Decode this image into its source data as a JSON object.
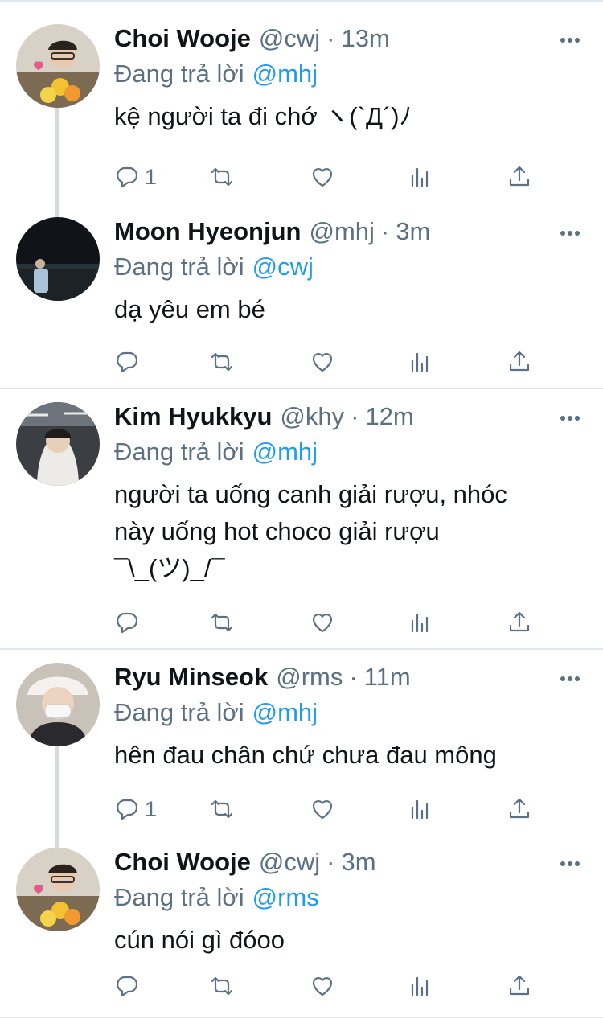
{
  "replying_prefix": "Đang trả lời",
  "tweets": [
    {
      "name": "Choi Wooje",
      "handle": "@cwj",
      "separator": "·",
      "time": "13m",
      "reply_to": "@mhj",
      "text": "kệ người ta đi chớ ヽ(`Д´)ﾉ",
      "reply_count": "1"
    },
    {
      "name": "Moon Hyeonjun",
      "handle": "@mhj",
      "separator": "·",
      "time": "3m",
      "reply_to": "@cwj",
      "text": "dạ yêu em bé",
      "reply_count": ""
    },
    {
      "name": "Kim Hyukkyu",
      "handle": "@khy",
      "separator": "·",
      "time": "12m",
      "reply_to": "@mhj",
      "text": "người ta uống canh giải rượu, nhóc\nnày uống hot choco giải rượu\n¯\\_(ツ)_/¯",
      "reply_count": ""
    },
    {
      "name": "Ryu Minseok",
      "handle": "@rms",
      "separator": "·",
      "time": "11m",
      "reply_to": "@mhj",
      "text": "hên đau chân chứ chưa đau mông",
      "reply_count": "1"
    },
    {
      "name": "Choi Wooje",
      "handle": "@cwj",
      "separator": "·",
      "time": "3m",
      "reply_to": "@rms",
      "text": "cún nói gì đóoo",
      "reply_count": ""
    }
  ],
  "icons": {
    "reply": "reply-icon",
    "retweet": "retweet-icon",
    "like": "heart-icon",
    "views": "views-icon",
    "share": "share-icon",
    "more": "more-icon"
  },
  "colors": {
    "mention": "#1d9bf0",
    "secondary_text": "#5b7083",
    "divider": "#e1e8ed",
    "thread_line": "#d5dade"
  }
}
